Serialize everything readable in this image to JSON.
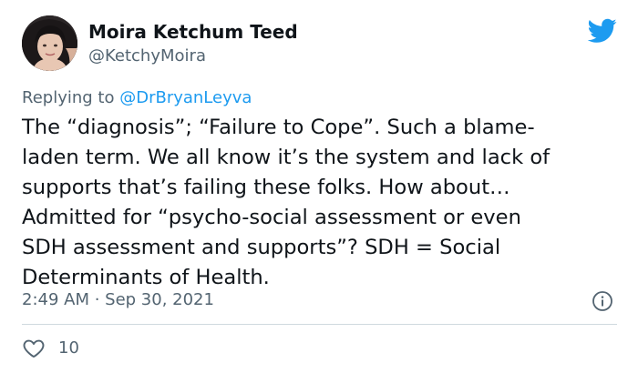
{
  "author": {
    "display_name": "Moira Ketchum Teed",
    "handle": "@KetchyMoira",
    "avatar_icon": "profile-photo"
  },
  "reply_context": {
    "prefix": "Replying to ",
    "mention": "@DrBryanLeyva"
  },
  "tweet": {
    "lines": [
      "The “diagnosis”; “Failure to Cope”.  Such a blame-",
      "laden term. We all know it’s the system and lack of",
      "supports that’s failing these folks. How about…",
      "Admitted for “psycho-social assessment or even",
      "SDH assessment and supports”? SDH = Social",
      "Determinants of Health."
    ]
  },
  "meta": {
    "timestamp": "2:49 AM · Sep 30, 2021"
  },
  "actions": {
    "like_count": "10"
  },
  "icons": {
    "brand": "twitter-bird-icon",
    "info": "info-icon",
    "like": "heart-icon"
  },
  "colors": {
    "brand_blue": "#1d9bf0",
    "text_primary": "#0f1419",
    "text_secondary": "#536471",
    "divider": "#cfd9de"
  }
}
